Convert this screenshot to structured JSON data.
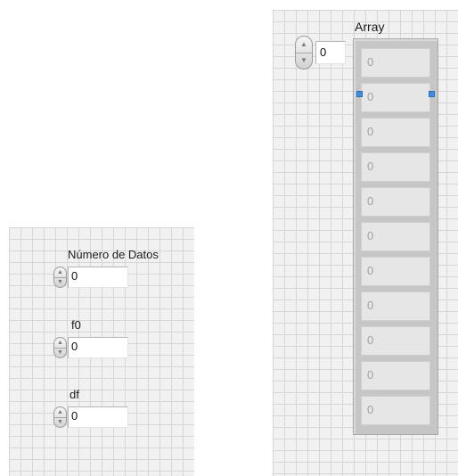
{
  "left_panel": {
    "controls": [
      {
        "label": "Número de Datos",
        "value": "0"
      },
      {
        "label": "f0",
        "value": "0"
      },
      {
        "label": "df",
        "value": "0"
      }
    ]
  },
  "array": {
    "label": "Array",
    "index_value": "0",
    "elements": [
      "0",
      "0",
      "0",
      "0",
      "0",
      "0",
      "0",
      "0",
      "0",
      "0",
      "0"
    ],
    "selected_element": 1,
    "colors": {
      "selection_handle": "#3d8ee0",
      "grid_background": "#f1f1f1",
      "array_frame": "#c6c6c6"
    }
  },
  "icons": {
    "spinner_up": "▲",
    "spinner_down": "▼"
  }
}
